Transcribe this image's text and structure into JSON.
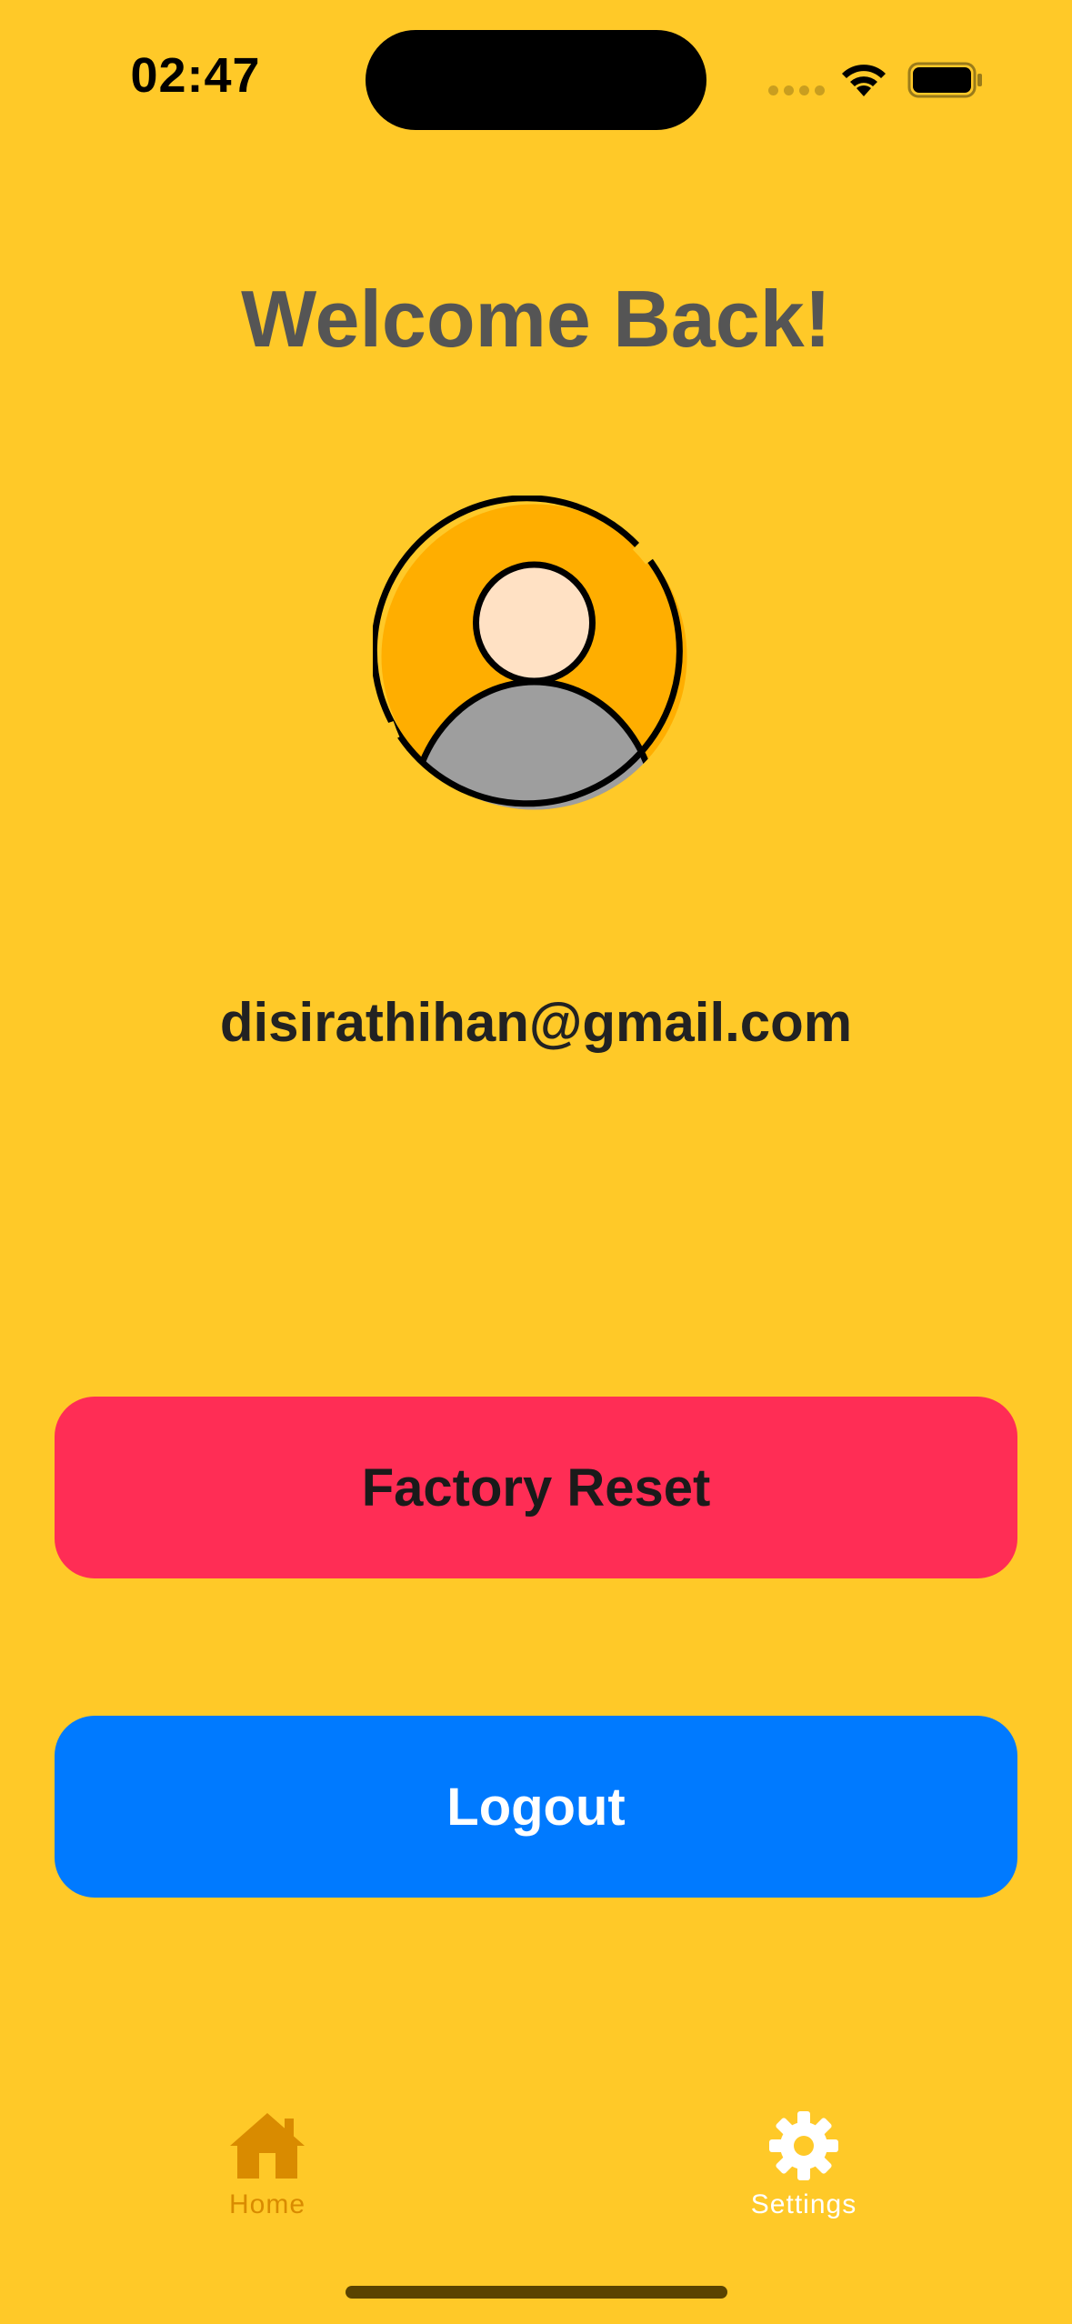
{
  "status_bar": {
    "time": "02:47",
    "icons": [
      "cellular-signal-icon",
      "wifi-icon",
      "battery-icon"
    ]
  },
  "header": {
    "title": "Welcome Back!"
  },
  "profile": {
    "avatar_icon": "user-avatar-icon",
    "email": "disirathihan@gmail.com"
  },
  "actions": {
    "factory_reset_label": "Factory Reset",
    "logout_label": "Logout"
  },
  "tab_bar": {
    "home_label": "Home",
    "home_icon": "house-icon",
    "settings_label": "Settings",
    "settings_icon": "gear-icon",
    "selected": "Settings"
  },
  "colors": {
    "background": "#FFC928",
    "factory_reset": "#FF2D55",
    "logout": "#007AFF",
    "home_tab": "#D98B00",
    "settings_tab": "#FFFFFF"
  }
}
